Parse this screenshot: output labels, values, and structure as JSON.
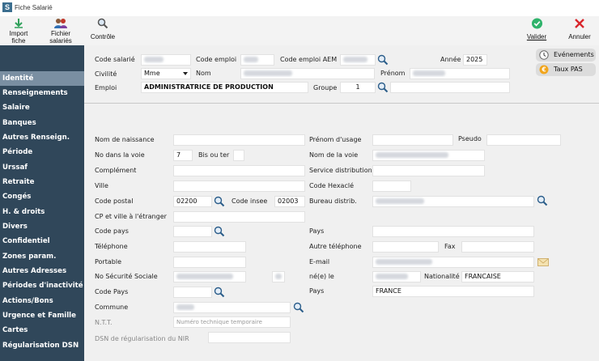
{
  "window": {
    "title": "Fiche Salarié",
    "icon_letter": "S"
  },
  "toolbar": {
    "import_label_1": "Import",
    "import_label_2": "fiche",
    "fichier_label_1": "Fichier",
    "fichier_label_2": "salariés",
    "controle_label": "Contrôle",
    "valider_label": "Valider",
    "annuler_label": "Annuler"
  },
  "sidebar": {
    "items": [
      {
        "label": "Identité"
      },
      {
        "label": "Renseignements"
      },
      {
        "label": "Salaire"
      },
      {
        "label": "Banques"
      },
      {
        "label": "Autres Renseign."
      },
      {
        "label": "Période"
      },
      {
        "label": "Urssaf"
      },
      {
        "label": "Retraite"
      },
      {
        "label": "Congés"
      },
      {
        "label": "H. & droits"
      },
      {
        "label": "Divers"
      },
      {
        "label": "Confidentiel"
      },
      {
        "label": "Zones param."
      },
      {
        "label": "Autres Adresses"
      },
      {
        "label": "Périodes d'inactivité"
      },
      {
        "label": "Actions/Bons"
      },
      {
        "label": "Urgence et Famille"
      },
      {
        "label": "Cartes"
      },
      {
        "label": "Régularisation DSN"
      }
    ]
  },
  "header": {
    "code_salarie_label": "Code salarié",
    "code_emploi_label": "Code emploi",
    "code_emploi_aem_label": "Code emploi AEM",
    "annee_label": "Année",
    "annee_value": "2025",
    "civilite_label": "Civilité",
    "civilite_value": "Mme",
    "nom_label": "Nom",
    "prenom_label": "Prénom",
    "emploi_label": "Emploi",
    "emploi_value": "ADMINISTRATRICE DE PRODUCTION",
    "groupe_label": "Groupe",
    "groupe_value": "1",
    "evenements_label": "Evénements",
    "taux_pas_label": "Taux PAS"
  },
  "form": {
    "nom_naissance_label": "Nom de naissance",
    "prenom_usage_label": "Prénom d'usage",
    "pseudo_label": "Pseudo",
    "no_voie_label": "No dans la voie",
    "no_voie_value": "7",
    "bis_ter_label": "Bis ou ter",
    "nom_voie_label": "Nom de la voie",
    "complement_label": "Complément",
    "service_distribution_label": "Service distribution",
    "ville_label": "Ville",
    "code_hexacle_label": "Code Hexaclé",
    "code_postal_label": "Code postal",
    "code_postal_value": "02200",
    "code_insee_label": "Code insee",
    "code_insee_value": "02003",
    "bureau_distrib_label": "Bureau distrib.",
    "cp_ville_etranger_label": "CP et ville à l'étranger",
    "code_pays_label": "Code pays",
    "pays_label": "Pays",
    "telephone_label": "Téléphone",
    "autre_telephone_label": "Autre téléphone",
    "fax_label": "Fax",
    "portable_label": "Portable",
    "email_label": "E-mail",
    "no_secu_label": "No Sécurité Sociale",
    "nee_le_label": "né(e) le",
    "nationalite_label": "Nationalité",
    "nationalite_value": "FRANCAISE",
    "code_pays2_label": "Code Pays",
    "pays2_label": "Pays",
    "pays2_value": "FRANCE",
    "commune_label": "Commune",
    "ntt_label": "N.T.T.",
    "ntt_placeholder": "Numéro technique temporaire",
    "dsn_regul_label": "DSN de régularisation du NIR"
  },
  "colors": {
    "sidebar_bg": "#30475a",
    "sidebar_active": "#7a8fa2",
    "valider": "#2fb36b",
    "annuler": "#d9262c",
    "import_arrow": "#2fa05a"
  }
}
